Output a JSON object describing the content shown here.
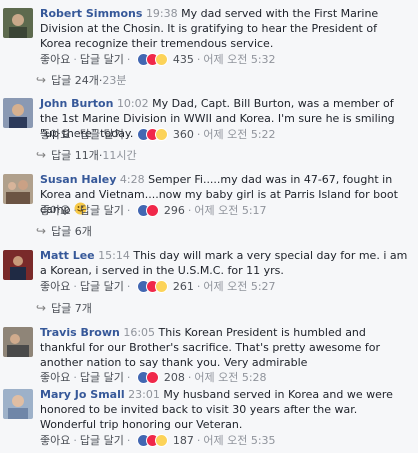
{
  "labels": {
    "like": "좋아요",
    "reply": "답글 달기",
    "sep": "·"
  },
  "comments": [
    {
      "author": "Robert Simmons",
      "time": "19:38",
      "text": "My dad served with the First Marine Division at the Chosin. It is gratifying to hear the President of Korea recognize their tremendous service.",
      "reactions": [
        "like",
        "love",
        "haha"
      ],
      "count": "435",
      "date": "어제 오전 5:32",
      "replies": "답글 24개",
      "replies_time": "23분"
    },
    {
      "author": "John Burton",
      "time": "10:02",
      "text": "My Dad, Capt. Bill Burton, was a member of the 1st Marine Division in WWII and Korea. I'm sure he is smiling \"up there\" today.",
      "reactions": [
        "like",
        "love",
        "wow"
      ],
      "count": "360",
      "date": "어제 오전 5:22",
      "replies": "답글 11개",
      "replies_time": "11시간"
    },
    {
      "author": "Susan Haley",
      "time": "4:28",
      "text": "Semper Fi.....my dad was in 47-67, fought in Korea and Vietnam....now my baby girl is at Parris Island for boot camp",
      "emoji": "smile-emoji",
      "reactions": [
        "like",
        "love"
      ],
      "count": "296",
      "date": "어제 오전 5:17",
      "replies": "답글 6개"
    },
    {
      "author": "Matt Lee",
      "time": "15:14",
      "text": "This day will mark a very special day for me. i am a Korean, i served in the U.S.M.C. for 11 yrs.",
      "reactions": [
        "like",
        "love",
        "haha"
      ],
      "count": "261",
      "date": "어제 오전 5:27",
      "replies": "답글 7개"
    },
    {
      "author": "Travis Brown",
      "time": "16:05",
      "text": "This Korean President is humbled and thankful for our Brother's sacrifice. That's pretty awesome for another nation to say thank you. Very admirable",
      "reactions": [
        "like",
        "love"
      ],
      "count": "208",
      "date": "어제 오전 5:28"
    },
    {
      "author": "Mary Jo Small",
      "time": "23:01",
      "text": "My husband served in Korea and we were honored to be invited back to visit 30 years after the war. Wonderful trip honoring our Veteran.",
      "reactions": [
        "like",
        "love",
        "haha"
      ],
      "count": "187",
      "date": "어제 오전 5:35"
    }
  ],
  "colors": {
    "author": "#365899",
    "meta": "#90949c",
    "like": "#4267b2",
    "love": "#f0284a",
    "haha": "#fcd359"
  }
}
